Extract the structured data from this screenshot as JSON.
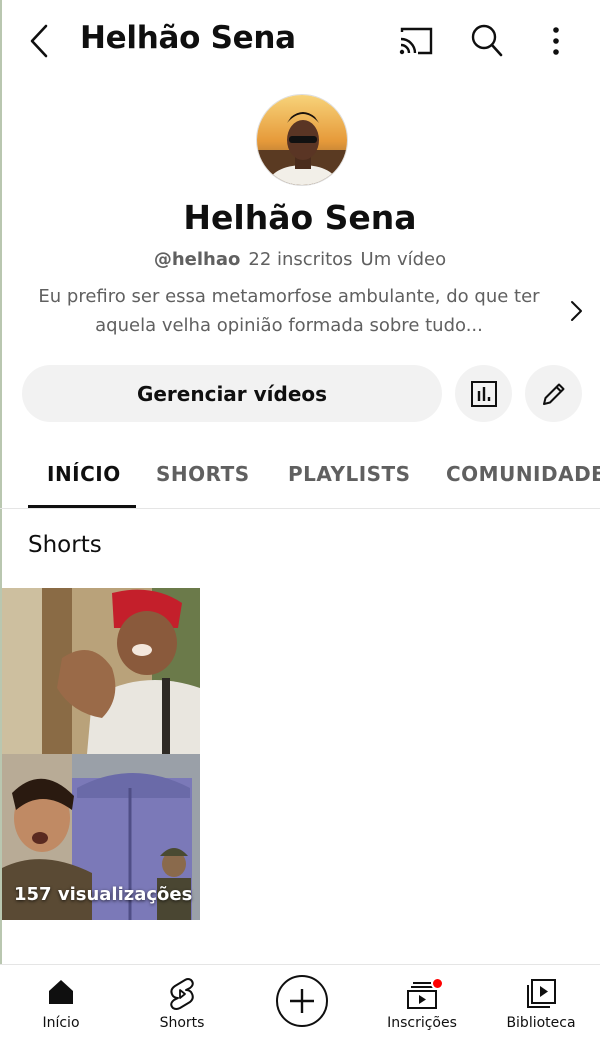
{
  "header": {
    "title": "Helhão Sena",
    "icons": [
      "back-icon",
      "cast-icon",
      "search-icon",
      "more-vert-icon"
    ]
  },
  "profile": {
    "name": "Helhão Sena",
    "handle": "@helhao",
    "subscribers": "22 inscritos",
    "video_count": "Um vídeo",
    "description": "Eu prefiro ser essa metamorfose ambulante, do que ter aquela velha opinião formada sobre tudo..."
  },
  "actions": {
    "manage_label": "Gerenciar vídeos"
  },
  "tabs": [
    {
      "label": "INÍCIO",
      "active": true
    },
    {
      "label": "SHORTS",
      "active": false
    },
    {
      "label": "PLAYLISTS",
      "active": false
    },
    {
      "label": "COMUNIDADE",
      "active": false
    }
  ],
  "shorts_section": {
    "title": "Shorts",
    "items": [
      {
        "views": "157 visualizações"
      }
    ]
  },
  "bottom_nav": [
    {
      "label": "Início",
      "icon": "home-icon"
    },
    {
      "label": "Shorts",
      "icon": "shorts-icon"
    },
    {
      "label": "",
      "icon": "create-icon"
    },
    {
      "label": "Inscrições",
      "icon": "subscriptions-icon",
      "badge": true
    },
    {
      "label": "Biblioteca",
      "icon": "library-icon"
    }
  ],
  "colors": {
    "text": "#0f0f0f",
    "secondary_text": "#606060",
    "chip_bg": "#f2f2f2",
    "badge": "#ff0000"
  }
}
